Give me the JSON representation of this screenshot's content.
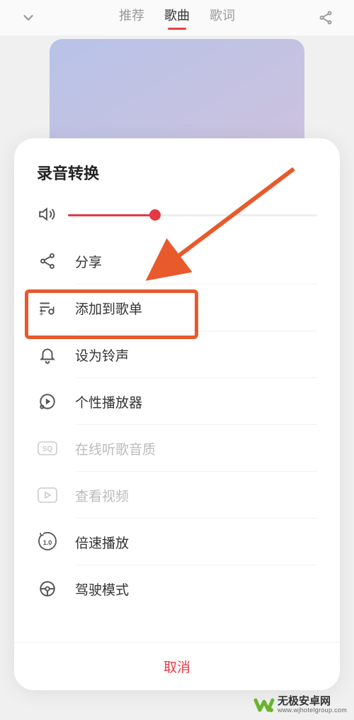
{
  "header": {
    "tabs": [
      "推荐",
      "歌曲",
      "歌词"
    ],
    "activeTab": 1
  },
  "modal": {
    "title": "录音转换",
    "volume": {
      "percent": 35
    },
    "items": [
      {
        "icon": "share-icon",
        "label": "分享",
        "disabled": false
      },
      {
        "icon": "add-playlist-icon",
        "label": "添加到歌单",
        "disabled": false,
        "highlighted": true
      },
      {
        "icon": "bell-icon",
        "label": "设为铃声",
        "disabled": false
      },
      {
        "icon": "player-icon",
        "label": "个性播放器",
        "disabled": false
      },
      {
        "icon": "sq-icon",
        "label": "在线听歌音质",
        "disabled": true
      },
      {
        "icon": "video-icon",
        "label": "查看视频",
        "disabled": true
      },
      {
        "icon": "speed-icon",
        "label": "倍速播放",
        "disabled": false
      },
      {
        "icon": "steering-icon",
        "label": "驾驶模式",
        "disabled": false
      }
    ],
    "cancel": "取消"
  },
  "watermark": {
    "title": "无极安卓网",
    "url": "www.wjhotelgroup.com"
  },
  "speed_value": "1.0"
}
